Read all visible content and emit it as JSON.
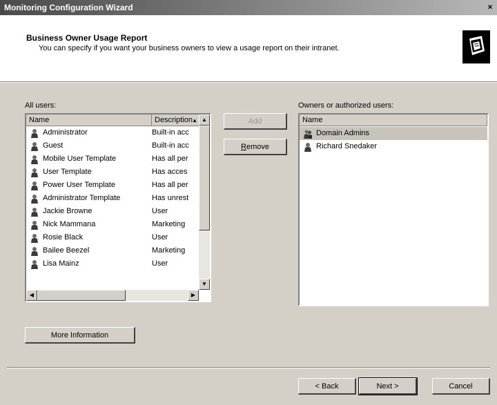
{
  "window": {
    "title": "Monitoring Configuration Wizard",
    "close_glyph": "×"
  },
  "header": {
    "title": "Business Owner Usage Report",
    "subtitle": "You can specify if you want your business owners to view a usage report on their intranet."
  },
  "all_users": {
    "label": "All users:",
    "columns": [
      "Name",
      "Description"
    ],
    "rows": [
      {
        "name": "Administrator",
        "desc": "Built-in acc"
      },
      {
        "name": "Guest",
        "desc": "Built-in acc"
      },
      {
        "name": "Mobile User Template",
        "desc": "Has all per"
      },
      {
        "name": "User Template",
        "desc": "Has acces"
      },
      {
        "name": "Power User Template",
        "desc": "Has all per"
      },
      {
        "name": "Administrator Template",
        "desc": "Has unrest"
      },
      {
        "name": "Jackie Browne",
        "desc": "User"
      },
      {
        "name": "Nick Mammana",
        "desc": "Marketing"
      },
      {
        "name": "Rosie Black",
        "desc": "User"
      },
      {
        "name": "Bailee Beezel",
        "desc": "Marketing"
      },
      {
        "name": "Lisa Mainz",
        "desc": "User"
      }
    ]
  },
  "buttons": {
    "add": "Add",
    "remove": "Remove",
    "more_info": "More Information",
    "back": "< Back",
    "next": "Next >",
    "cancel": "Cancel"
  },
  "owners": {
    "label": "Owners or authorized users:",
    "column": "Name",
    "rows": [
      {
        "name": "Domain Admins",
        "kind": "group-icon"
      },
      {
        "name": "Richard Snedaker",
        "kind": "user-icon"
      }
    ]
  },
  "colors": {
    "title_bar": "#4a4a4a",
    "dialog_face": "#d4d0c8"
  }
}
